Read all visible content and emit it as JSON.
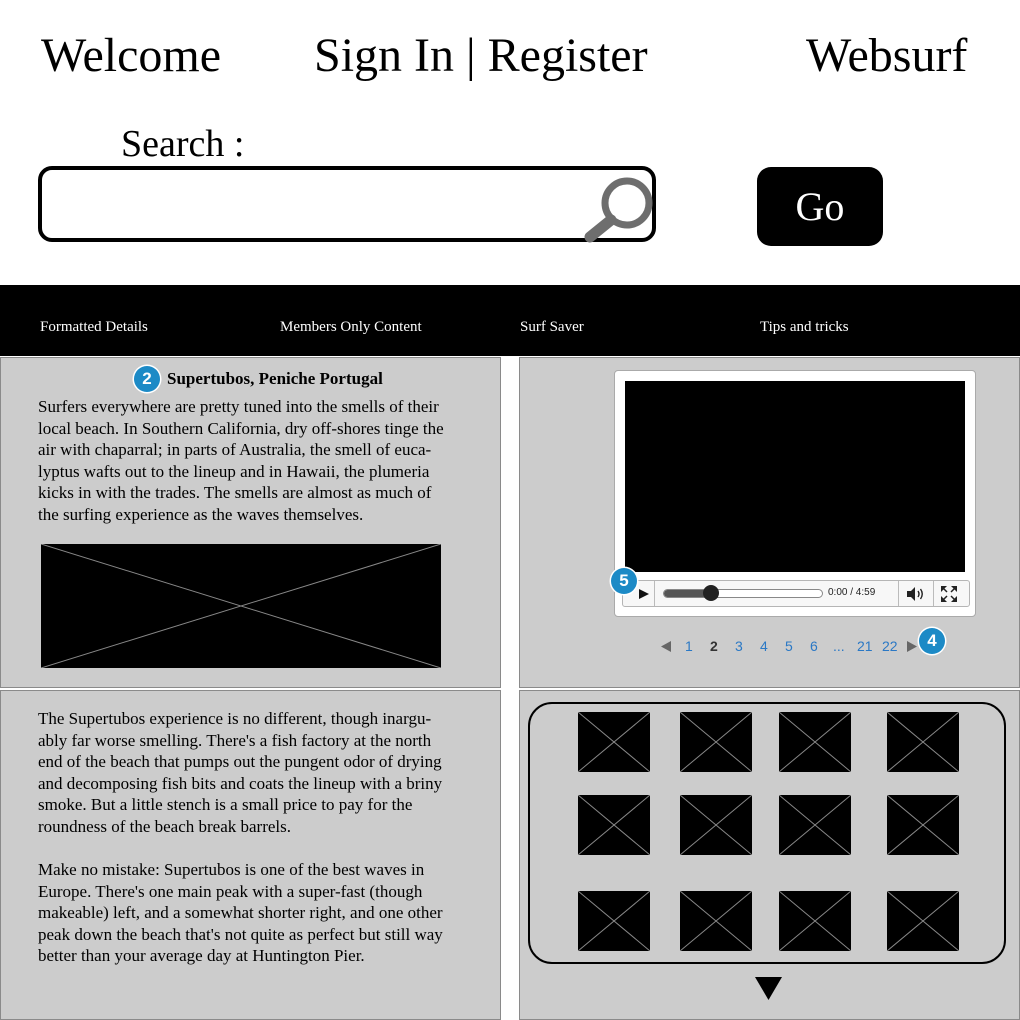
{
  "header": {
    "welcome": "Welcome",
    "auth": "Sign In | Register",
    "brand": "Websurf"
  },
  "search": {
    "label": "Search :",
    "placeholder": "",
    "value": "",
    "icon": "search-icon",
    "go_label": "Go"
  },
  "nav": {
    "items": [
      "Formatted Details",
      "Members Only Content",
      "Surf Saver",
      "Tips and tricks"
    ]
  },
  "article": {
    "badge": "2",
    "title": "Supertubos, Peniche Portugal",
    "intro_lines": [
      "Surfers everywhere are pretty tuned into the smells of their",
      "local beach. In Southern California, dry off-shores tinge the",
      "air with chaparral; in parts of Australia, the smell of euca-",
      "lyptus wafts out to the lineup and in Hawaii, the plumeria",
      "kicks in with the trades. The smells are almost as much of",
      "the surfing experience as the waves themselves."
    ],
    "p2_lines": [
      "The Supertubos experience is no different, though inargu-",
      "ably far worse smelling. There's a fish factory at the north",
      "end of the beach that pumps out the pungent odor of drying",
      "and decomposing fish bits and coats the lineup with a briny",
      "smoke. But a little stench is a small price to pay for the",
      "roundness of the beach break barrels."
    ],
    "p3_lines": [
      "Make no mistake: Supertubos is one of the best waves in",
      "Europe. There's one main peak with a super-fast (though",
      "makeable) left, and a somewhat shorter right, and one other",
      "peak down the beach that's not quite as perfect but still way",
      "better than your average day at Huntington Pier."
    ]
  },
  "video": {
    "badge": "5",
    "time": "0:00 / 4:59",
    "progress": 0.3
  },
  "pagination": {
    "badge": "4",
    "pages": [
      "1",
      "2",
      "3",
      "4",
      "5",
      "6",
      "...",
      "21",
      "22"
    ],
    "current": "2"
  },
  "colors": {
    "badge": "#1c8ac6",
    "panel": "#cccccc",
    "link": "#2a78c5"
  }
}
